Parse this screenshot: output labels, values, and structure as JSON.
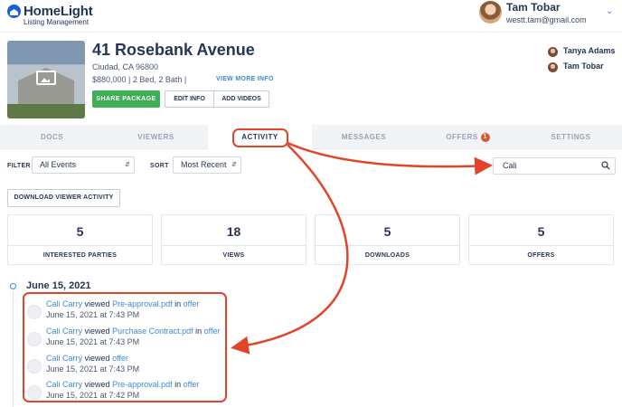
{
  "app": {
    "logo_name": "HomeLight",
    "logo_subtitle": "Listing Management"
  },
  "user": {
    "name": "Tam Tobar",
    "email": "westt.tam@gmail.com"
  },
  "property": {
    "title": "41 Rosebank Avenue",
    "city": "Ciudad, CA 96800",
    "details": "$880,000 | 2 Bed, 2 Bath |",
    "view_more": "VIEW MORE INFO",
    "buttons": {
      "share": "SHARE PACKAGE",
      "edit": "EDIT INFO",
      "videos": "ADD VIDEOS"
    },
    "collaborators": [
      "Tanya Adams",
      "Tam Tobar"
    ]
  },
  "tabs": [
    {
      "label": "DOCS"
    },
    {
      "label": "VIEWERS"
    },
    {
      "label": "ACTIVITY",
      "active": true
    },
    {
      "label": "MESSAGES"
    },
    {
      "label": "OFFERS",
      "badge": "1"
    },
    {
      "label": "SETTINGS"
    }
  ],
  "filters": {
    "filter_label": "FILTER",
    "filter_value": "All Events",
    "sort_label": "SORT",
    "sort_value": "Most Recent",
    "search_value": "Cali"
  },
  "download_button": "DOWNLOAD VIEWER ACTIVITY",
  "stats": [
    {
      "value": "5",
      "label": "INTERESTED PARTIES"
    },
    {
      "value": "18",
      "label": "VIEWS"
    },
    {
      "value": "5",
      "label": "DOWNLOADS"
    },
    {
      "value": "5",
      "label": "OFFERS"
    }
  ],
  "timeline": {
    "date": "June 15, 2021",
    "word_viewed": "viewed",
    "word_in": "in",
    "items": [
      {
        "name": "Cali Carry",
        "doc": "Pre-approval.pdf",
        "context": "offer",
        "time": "June 15, 2021 at 7:43 PM"
      },
      {
        "name": "Cali Carry",
        "doc": "Purchase Contract.pdf",
        "context": "offer",
        "time": "June 15, 2021 at 7:43 PM"
      },
      {
        "name": "Cali Carry",
        "doc": "offer",
        "context": "",
        "time": "June 15, 2021 at 7:43 PM"
      },
      {
        "name": "Cali Carry",
        "doc": "Pre-approval.pdf",
        "context": "offer",
        "time": "June 15, 2021 at 7:42 PM"
      }
    ]
  },
  "colors": {
    "accent": "#3d8ad8",
    "share_green": "#3fae55",
    "annotation_red": "#e2442a",
    "badge": "#e2522d"
  }
}
